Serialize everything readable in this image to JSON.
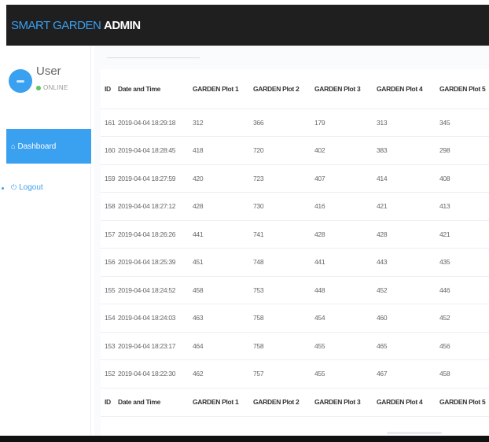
{
  "header": {
    "brand_part1": "SMART GARDEN",
    "brand_part2": "ADMIN"
  },
  "sidebar": {
    "user": {
      "name": "User",
      "status": "ONLINE",
      "status_color": "#62c462"
    },
    "items": [
      {
        "label": "Dashboard",
        "icon": "home-icon",
        "active": true
      },
      {
        "label": "Logout",
        "icon": "power-icon",
        "active": false
      }
    ]
  },
  "table": {
    "columns": [
      "ID",
      "Date and Time",
      "GARDEN Plot 1",
      "GARDEN Plot 2",
      "GARDEN Plot 3",
      "GARDEN Plot 4",
      "GARDEN Plot 5"
    ],
    "rows": [
      [
        "161",
        "2019-04-04 18:29:18",
        "312",
        "366",
        "179",
        "313",
        "345"
      ],
      [
        "160",
        "2019-04-04 18:28:45",
        "418",
        "720",
        "402",
        "383",
        "298"
      ],
      [
        "159",
        "2019-04-04 18:27:59",
        "420",
        "723",
        "407",
        "414",
        "408"
      ],
      [
        "158",
        "2019-04-04 18:27:12",
        "428",
        "730",
        "416",
        "421",
        "413"
      ],
      [
        "157",
        "2019-04-04 18:26:26",
        "441",
        "741",
        "428",
        "428",
        "421"
      ],
      [
        "156",
        "2019-04-04 18:25:39",
        "451",
        "748",
        "441",
        "443",
        "435"
      ],
      [
        "155",
        "2019-04-04 18:24:52",
        "458",
        "753",
        "448",
        "452",
        "446"
      ],
      [
        "154",
        "2019-04-04 18:24:03",
        "463",
        "758",
        "454",
        "460",
        "452"
      ],
      [
        "153",
        "2019-04-04 18:23:17",
        "464",
        "758",
        "455",
        "465",
        "456"
      ],
      [
        "152",
        "2019-04-04 18:22:30",
        "462",
        "757",
        "455",
        "467",
        "458"
      ]
    ]
  },
  "colors": {
    "accent": "#3aa0f0",
    "topbar": "#1f1f1f"
  }
}
